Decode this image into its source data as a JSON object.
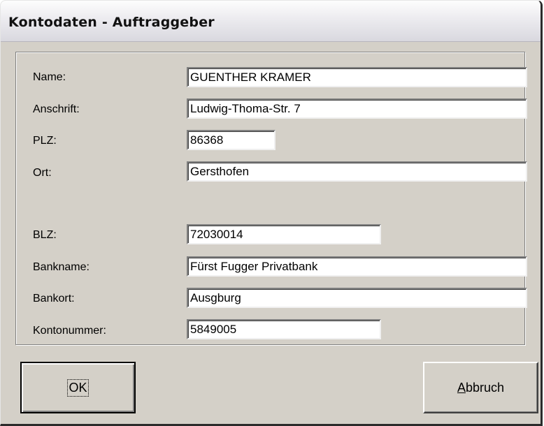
{
  "window": {
    "title": "Kontodaten - Auftraggeber"
  },
  "fields": [
    {
      "id": "name",
      "label": "Name:",
      "value": "GUENTHER KRAMER"
    },
    {
      "id": "anschrift",
      "label": "Anschrift:",
      "value": "Ludwig-Thoma-Str. 7"
    },
    {
      "id": "plz",
      "label": "PLZ:",
      "value": "86368"
    },
    {
      "id": "ort",
      "label": "Ort:",
      "value": "Gersthofen"
    },
    {
      "id": "blz",
      "label": "BLZ:",
      "value": "72030014"
    },
    {
      "id": "bankname",
      "label": "Bankname:",
      "value": "Fürst Fugger Privatbank"
    },
    {
      "id": "bankort",
      "label": "Bankort:",
      "value": "Ausgburg"
    },
    {
      "id": "kontonummer",
      "label": "Kontonummer:",
      "value": "5849005"
    }
  ],
  "buttons": {
    "ok_label": "OK",
    "cancel_first": "A",
    "cancel_rest": "bbruch"
  }
}
